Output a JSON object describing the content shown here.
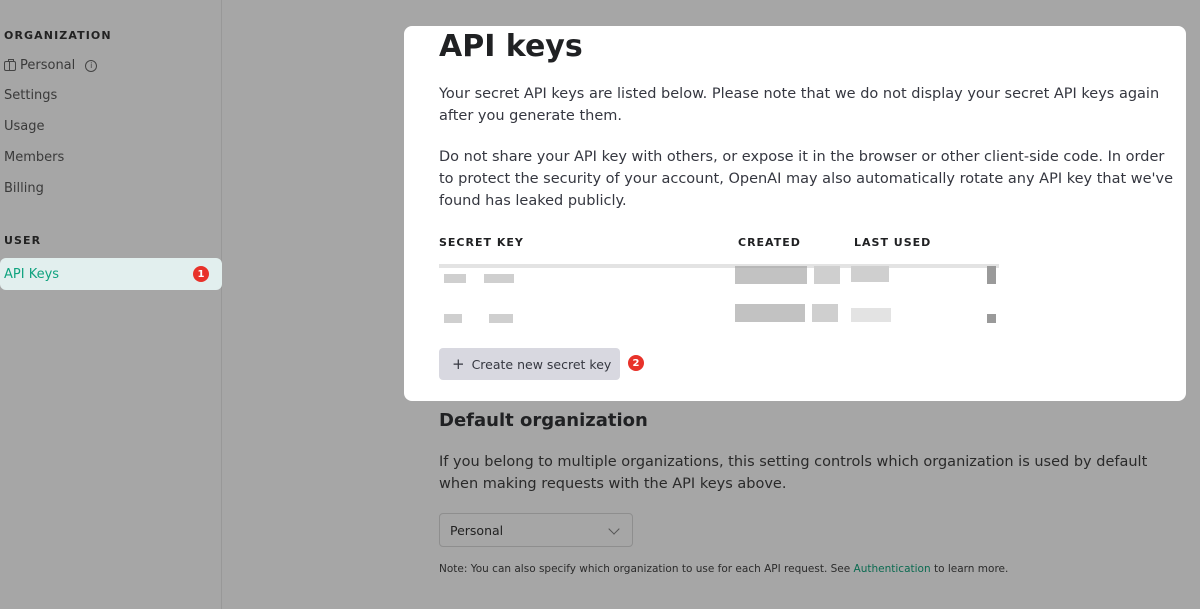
{
  "sidebar": {
    "organization_heading": "ORGANIZATION",
    "org_items": [
      "Personal",
      "Settings",
      "Usage",
      "Members",
      "Billing"
    ],
    "user_heading": "USER",
    "api_keys_label": "API Keys",
    "api_keys_badge": "1"
  },
  "card": {
    "title": "API keys",
    "intro": "Your secret API keys are listed below. Please note that we do not display your secret API keys again after you generate them.",
    "warning": "Do not share your API key with others, or expose it in the browser or other client-side code. In order to protect the security of your account, OpenAI may also automatically rotate any API key that we've found has leaked publicly.",
    "columns": [
      "SECRET KEY",
      "CREATED",
      "LAST USED"
    ],
    "create_button_label": "Create new secret key",
    "create_button_badge": "2"
  },
  "default_org": {
    "title": "Default organization",
    "description": "If you belong to multiple organizations, this setting controls which organization is used by default when making requests with the API keys above.",
    "select_value": "Personal",
    "note_prefix": "Note: You can also specify which organization to use for each API request. See ",
    "note_link": "Authentication",
    "note_suffix": " to learn more."
  },
  "colors": {
    "accent": "#10a37f",
    "badge": "#e8322a",
    "overlay_background": "#a6a6a6"
  }
}
